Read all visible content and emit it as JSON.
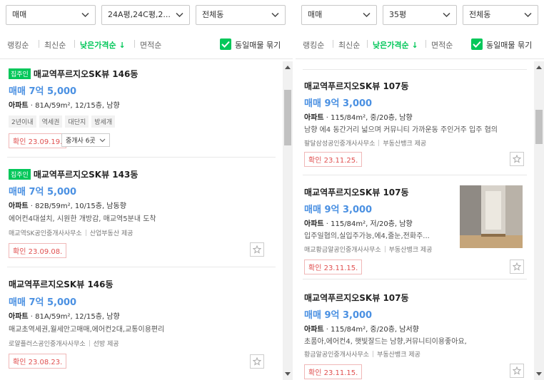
{
  "left": {
    "filters": {
      "trade_type": "매매",
      "area": "24A평,24C평,2...",
      "dong": "전체동"
    },
    "sort": {
      "ranking": "랭킹순",
      "newest": "최신순",
      "lowest_price": "낮은가격순",
      "lowest_price_arrow": "↓",
      "by_area": "면적순"
    },
    "group_same": "동일매물 묶기",
    "listings": [
      {
        "badge": "집주인",
        "title": "매교역푸르지오SK뷰 146동",
        "price": "매매 7억 5,000",
        "type": "아파트",
        "spec": " · 81A/59m², 12/15층, 남향",
        "tags": [
          "2년이내",
          "역세권",
          "대단지",
          "방세개"
        ],
        "confirmed": "확인 23.09.19.",
        "agent_count": "중개사 6곳"
      },
      {
        "badge": "집주인",
        "title": "매교역푸르지오SK뷰 143동",
        "price": "매매 7억 5,000",
        "type": "아파트",
        "spec": " · 82B/59m², 10/15층, 남동향",
        "desc": "에어컨4대설치, 시원한 개방감, 매교역5분내 도착",
        "agent": "매교역SK공인중개사사무소",
        "provider": "산업부동산 제공",
        "confirmed": "확인 23.09.08."
      },
      {
        "title": "매교역푸르지오SK뷰 146동",
        "price": "매매 7억 5,000",
        "type": "아파트",
        "spec": " · 81A/59m², 12/15층, 남향",
        "desc": "매교초역세권,월세안고매매,에어컨2대,교통이용편리",
        "agent": "로얄플러스공인중개사사무소",
        "provider": "선방 제공",
        "confirmed": "확인 23.08.23."
      }
    ]
  },
  "right": {
    "filters": {
      "trade_type": "매매",
      "area": "35평",
      "dong": "전체동"
    },
    "sort": {
      "ranking": "랭킹순",
      "newest": "최신순",
      "lowest_price": "낮은가격순",
      "lowest_price_arrow": "↓",
      "by_area": "면적순"
    },
    "group_same": "동일매물 묶기",
    "listings": [
      {
        "title": "매교역푸르지오SK뷰 107동",
        "price": "매매 9억 3,000",
        "type": "아파트",
        "spec": " · 115/84m², 중/20층, 남향",
        "desc": "남향 에4 동간거리 넓으며 커뮤니티 가까운동 주인거주 입주 협의",
        "agent": "팔달삼성공인중개사사무소",
        "provider": "부동산뱅크 제공",
        "confirmed": "확인 23.11.25."
      },
      {
        "title": "매교역푸르지오SK뷰 107동",
        "price": "매매 9억 3,000",
        "type": "아파트",
        "spec": " · 115/84m², 저/20층, 남향",
        "desc": "입주일협의,실입주가능,에4,줄눈,전화주...",
        "agent": "매교황금알공인중개사사무소",
        "provider": "부동산뱅크 제공",
        "confirmed": "확인 23.11.15."
      },
      {
        "title": "매교역푸르지오SK뷰 107동",
        "price": "매매 9억 3,000",
        "type": "아파트",
        "spec": " · 115/84m², 중/20층, 남서향",
        "desc": "초품아,에어컨4, 햇빛잘드는 남향,커뮤니티이용좋아요,",
        "agent": "황금알공인중개사사무소",
        "provider": "부동산뱅크 제공",
        "confirmed": "확인 23.11.15."
      }
    ]
  },
  "colors": {
    "accent_green": "#03c75a",
    "price_blue": "#4a90e2",
    "confirm_red": "#e05050"
  },
  "icons": {
    "dropdown": "chevron-down-icon",
    "check": "check-icon",
    "favorite": "star-outline-icon"
  }
}
